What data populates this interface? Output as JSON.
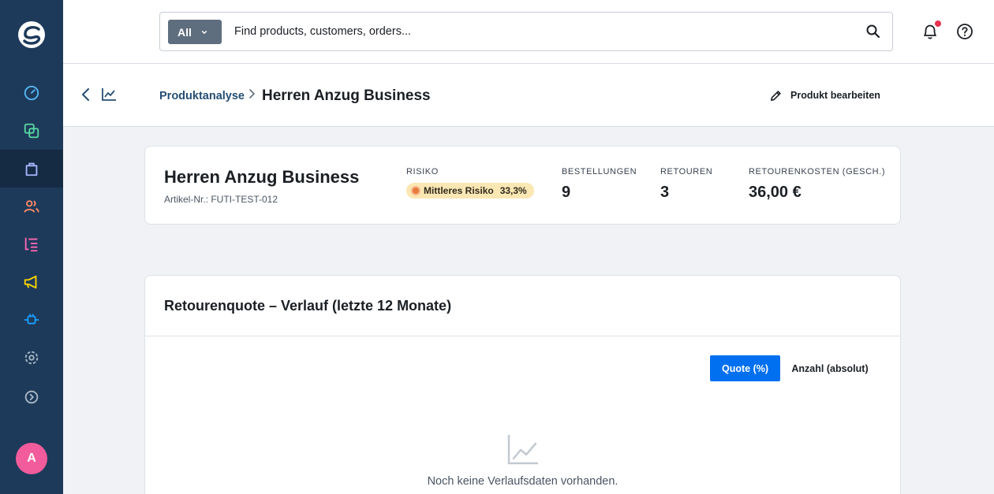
{
  "sidebar": {
    "logo": "shopware-logo",
    "items": [
      {
        "icon": "dashboard-gauge-icon",
        "color": "#57b8f5"
      },
      {
        "icon": "catalog-copy-icon",
        "color": "#57d9a3"
      },
      {
        "icon": "orders-bag-icon",
        "color": "#a7b8ff",
        "active": true
      },
      {
        "icon": "customers-users-icon",
        "color": "#ff8a65"
      },
      {
        "icon": "content-list-icon",
        "color": "#ff68b4"
      },
      {
        "icon": "marketing-megaphone-icon",
        "color": "#ffd700"
      },
      {
        "icon": "extensions-plug-icon",
        "color": "#189eff"
      },
      {
        "icon": "settings-gear-icon",
        "color": "#a9b8c9"
      },
      {
        "icon": "expand-arrow-icon",
        "color": "#a9b8c9"
      }
    ],
    "avatar_letter": "A",
    "avatar_color": "#f25c9c"
  },
  "topbar": {
    "search_type": "All",
    "search_placeholder": "Find products, customers, orders...",
    "notification_dot_color": "#e8314f"
  },
  "header": {
    "breadcrumb_link": "Produktanalyse",
    "title": "Herren Anzug Business",
    "edit_label": "Produkt bearbeiten"
  },
  "summary": {
    "product_name": "Herren Anzug Business",
    "sku": "Artikel-Nr.: FUTI-TEST-012",
    "risk_label": "RISIKO",
    "risk_badge": "Mittleres Risiko",
    "risk_percent": "33,3%",
    "orders_label": "BESTELLUNGEN",
    "orders_value": "9",
    "returns_label": "RETOUREN",
    "returns_value": "3",
    "cost_label": "RETOURENKOSTEN (GESCH.)",
    "cost_value": "36,00 €"
  },
  "history": {
    "title": "Retourenquote – Verlauf (letzte 12 Monate)",
    "toggle_percent": "Quote (%)",
    "toggle_absolute": "Anzahl (absolut)",
    "active_toggle": "percent",
    "empty_message": "Noch keine Verlaufsdaten vorhanden."
  },
  "colors": {
    "sidebar_bg": "#1e3a5a",
    "accent": "#0070f0",
    "link": "#264e73"
  }
}
